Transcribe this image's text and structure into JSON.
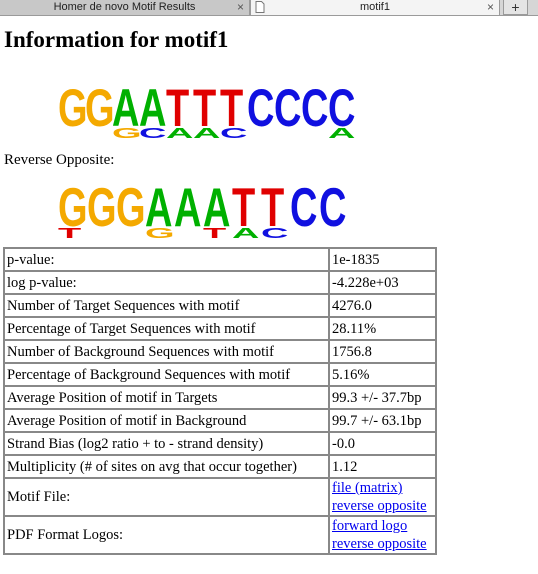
{
  "tabs": [
    {
      "label": "Homer de novo Motif Results",
      "active": false
    },
    {
      "label": "motif1",
      "active": true
    }
  ],
  "new_tab_label": "+",
  "close_glyph": "×",
  "page_title": "Information for motif1",
  "reverse_label": "Reverse Opposite:",
  "logo_forward": {
    "letters": [
      "G",
      "G",
      "A",
      "A",
      "T",
      "T",
      "T",
      "C",
      "C",
      "C",
      "C"
    ],
    "secondary": [
      "",
      "",
      "G",
      "C",
      "A",
      "A",
      "C",
      "",
      "",
      "",
      "A"
    ]
  },
  "logo_reverse": {
    "letters": [
      "G",
      "G",
      "G",
      "A",
      "A",
      "A",
      "T",
      "T",
      "C",
      "C"
    ],
    "secondary": [
      "T",
      "",
      "",
      "G",
      "",
      "T",
      "A",
      "C",
      "",
      ""
    ]
  },
  "colors": {
    "A": "#00b000",
    "C": "#1010e0",
    "G": "#f4a900",
    "T": "#e00000",
    "link": "#0000ee"
  },
  "stats": [
    {
      "label": "p-value:",
      "value": "1e-1835"
    },
    {
      "label": "log p-value:",
      "value": "-4.228e+03"
    },
    {
      "label": "Number of Target Sequences with motif",
      "value": "4276.0"
    },
    {
      "label": "Percentage of Target Sequences with motif",
      "value": "28.11%"
    },
    {
      "label": "Number of Background Sequences with motif",
      "value": "1756.8"
    },
    {
      "label": "Percentage of Background Sequences with motif",
      "value": "5.16%"
    },
    {
      "label": "Average Position of motif in Targets",
      "value": "99.3 +/- 37.7bp"
    },
    {
      "label": "Average Position of motif in Background",
      "value": "99.7 +/- 63.1bp"
    },
    {
      "label": "Strand Bias (log2 ratio + to - strand density)",
      "value": "-0.0"
    },
    {
      "label": "Multiplicity (# of sites on avg that occur together)",
      "value": "1.12"
    }
  ],
  "motif_file": {
    "label": "Motif File:",
    "links": [
      "file (matrix)",
      "reverse opposite"
    ]
  },
  "pdf_logos": {
    "label": "PDF Format Logos:",
    "links": [
      "forward logo",
      "reverse opposite"
    ]
  }
}
